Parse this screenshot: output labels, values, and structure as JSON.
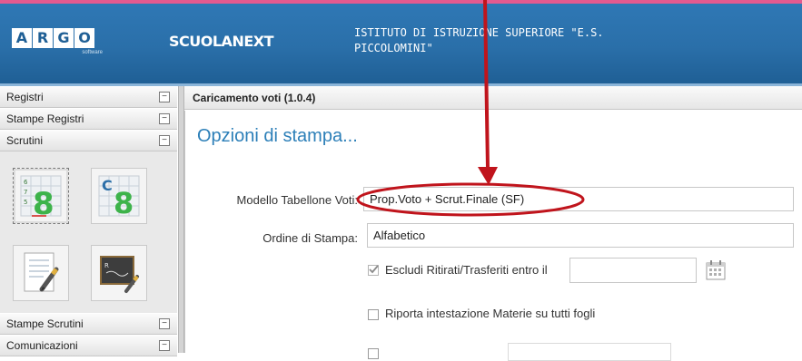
{
  "header": {
    "logo_letters": [
      "A",
      "R",
      "G",
      "O"
    ],
    "logo_subtitle": "software",
    "product_name": "SCUOLANEXT",
    "institute_line1": "ISTITUTO DI ISTRUZIONE SUPERIORE \"E.S.",
    "institute_line2": "PICCOLOMINI\"",
    "background_color": "#2a6fa9"
  },
  "sidebar": {
    "items": [
      {
        "label": "Registri",
        "toggle": "⊟"
      },
      {
        "label": "Stampe Registri",
        "toggle": "⊟"
      },
      {
        "label": "Scrutini",
        "toggle": "⊟"
      },
      {
        "label": "Stampe Scrutini",
        "toggle": "⊟"
      },
      {
        "label": "Comunicazioni",
        "toggle": "⊟"
      }
    ],
    "tiles": [
      {
        "icon": "voti-tabellone-icon"
      },
      {
        "icon": "voti-refresh-icon"
      },
      {
        "icon": "document-pencil-icon"
      },
      {
        "icon": "blackboard-pencil-icon"
      }
    ]
  },
  "panel": {
    "title": "Caricamento voti (1.0.4)",
    "section_title": "Opzioni di stampa...",
    "fields": {
      "modello_label": "Modello Tabellone Voti:",
      "modello_value": "Prop.Voto + Scrut.Finale (SF)",
      "ordine_label": "Ordine di Stampa:",
      "ordine_value": "Alfabetico",
      "escludi_label": "Escludi Ritirati/Trasferiti entro il",
      "escludi_date": "",
      "riporta_label": "Riporta intestazione Materie su tutti fogli"
    },
    "accent_color": "#2c7fb8"
  },
  "annotation": {
    "arrow_color": "#c0141c",
    "ellipse_color": "#c0141c"
  }
}
